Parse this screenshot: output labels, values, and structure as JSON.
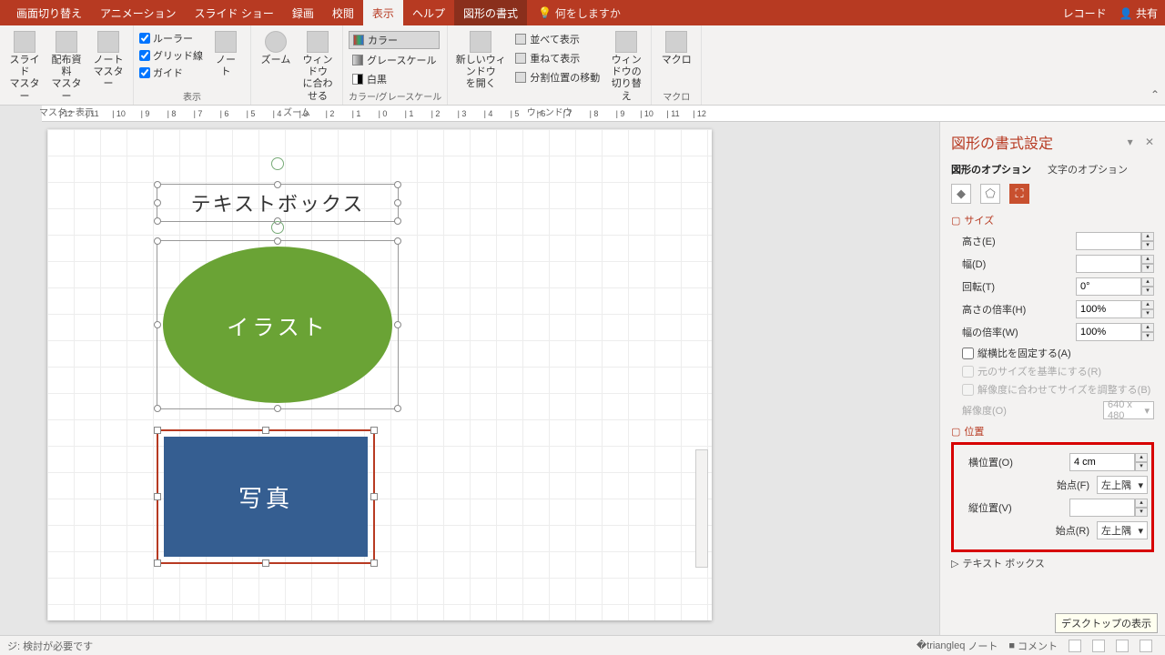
{
  "titlebar": {
    "tabs": [
      "画面切り替え",
      "アニメーション",
      "スライド ショー",
      "録画",
      "校閲",
      "表示",
      "ヘルプ",
      "図形の書式"
    ],
    "active_tab": "表示",
    "tellme_icon": "lightbulb-icon",
    "tellme": "何をしますか",
    "record": "レコード",
    "share": "共有"
  },
  "ribbon": {
    "master": {
      "slide": "スライド\nマスター",
      "handout": "配布資料\nマスター",
      "notes": "ノート\nマスター",
      "label": "マスター表示"
    },
    "show": {
      "ruler": "ルーラー",
      "grid": "グリッド線",
      "guide": "ガイド",
      "note_btn": "ノー\nト",
      "label": "表示"
    },
    "zoom": {
      "zoom": "ズーム",
      "fit": "ウィンドウ\nに合わせる",
      "label": "ズーム"
    },
    "color": {
      "color": "カラー",
      "gray": "グレースケール",
      "bw": "白黒",
      "label": "カラー/グレースケール"
    },
    "window": {
      "neww": "新しいウィンドウ\nを開く",
      "arrange": "並べて表示",
      "cascade": "重ねて表示",
      "split": "分割位置の移動",
      "switch": "ウィンドウの\n切り替え",
      "label": "ウィンドウ"
    },
    "macro": {
      "macro": "マクロ",
      "label": "マクロ"
    }
  },
  "ruler_marks": [
    "12",
    "11",
    "10",
    "9",
    "8",
    "7",
    "6",
    "5",
    "4",
    "3",
    "2",
    "1",
    "0",
    "1",
    "2",
    "3",
    "4",
    "5",
    "6",
    "7",
    "8",
    "9",
    "10",
    "11",
    "12"
  ],
  "slide": {
    "textbox": "テキストボックス",
    "oval": "イラスト",
    "rect": "写真"
  },
  "pane": {
    "title": "図形の書式設定",
    "tab_shape": "図形のオプション",
    "tab_text": "文字のオプション",
    "sect_size": "サイズ",
    "height": "高さ(E)",
    "width": "幅(D)",
    "rotation": "回転(T)",
    "rotation_val": "0°",
    "scale_h": "高さの倍率(H)",
    "scale_h_val": "100%",
    "scale_w": "幅の倍率(W)",
    "scale_w_val": "100%",
    "lock": "縦横比を固定する(A)",
    "orig": "元のサイズを基準にする(R)",
    "reso": "解像度に合わせてサイズを調整する(B)",
    "resolution": "解像度(O)",
    "resolution_val": "640 x 480",
    "sect_pos": "位置",
    "hpos": "横位置(O)",
    "hpos_val": "4 cm",
    "from_h": "始点(F)",
    "from_h_val": "左上隅",
    "vpos": "縦位置(V)",
    "vpos_val": "",
    "from_v": "始点(R)",
    "from_v_val": "左上隅",
    "sect_tb": "テキスト ボックス"
  },
  "status": {
    "left": "ジ: 検討が必要です",
    "notes": "ノート",
    "comments": "コメント",
    "tooltip": "デスクトップの表示"
  }
}
